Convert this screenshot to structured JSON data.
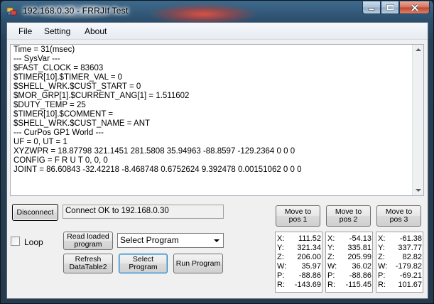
{
  "window": {
    "title": "192.168.0.30 - FRRJIf Test",
    "controls": {
      "minimize": "minimize",
      "maximize": "maximize",
      "close": "close"
    }
  },
  "menu": {
    "items": [
      "File",
      "Setting",
      "About"
    ]
  },
  "log": {
    "lines": [
      "Time = 31(msec)",
      "--- SysVar ---",
      "$FAST_CLOCK = 83603",
      "$TIMER[10].$TIMER_VAL = 0",
      "$SHELL_WRK.$CUST_START = 0",
      "$MOR_GRP[1].$CURRENT_ANG[1] = 1.511602",
      "$DUTY_TEMP = 25",
      "$TIMER[10].$COMMENT =",
      "$SHELL_WRK.$CUST_NAME = ANT",
      "--- CurPos GP1 World ---",
      "UF = 0, UT = 1",
      "XYZWPR = 18.87798 321.1451 281.5808 35.94963 -88.8597 -129.2364 0 0 0",
      "CONFIG = F R U T 0, 0, 0",
      "JOINT = 86.60843 -32.42218 -8.468748 0.6752624 9.392478 0.00151062 0 0 0"
    ]
  },
  "connection": {
    "disconnect_label": "Disconnect",
    "status_text": "Connect OK to 192.168.0.30"
  },
  "controls": {
    "loop_label": "Loop",
    "loop_checked": false,
    "read_loaded_label": "Read loaded program",
    "refresh_label": "Refresh DataTable2",
    "select_program_button_label": "Select Program",
    "run_program_label": "Run Program",
    "program_select_value": "Select Program"
  },
  "positions": [
    {
      "button": "Move to pos 1",
      "X": "111.52",
      "Y": "321.34",
      "Z": "206.00",
      "W": "35.97",
      "P": "-88.86",
      "R": "-143.69"
    },
    {
      "button": "Move to pos 2",
      "X": "-54.13",
      "Y": "335.81",
      "Z": "205.99",
      "W": "36.02",
      "P": "-88.86",
      "R": "-115.45"
    },
    {
      "button": "Move to pos 3",
      "X": "-61.38",
      "Y": "337.77",
      "Z": "82.82",
      "W": "-179.82",
      "P": "-69.21",
      "R": "101.67"
    }
  ],
  "axis_labels": [
    "X:",
    "Y:",
    "Z:",
    "W:",
    "P:",
    "R:"
  ],
  "colors": {
    "window_frame": "#2c4f6d",
    "client_bg": "#f0f0f0",
    "focus_border": "#3c7fb1"
  }
}
